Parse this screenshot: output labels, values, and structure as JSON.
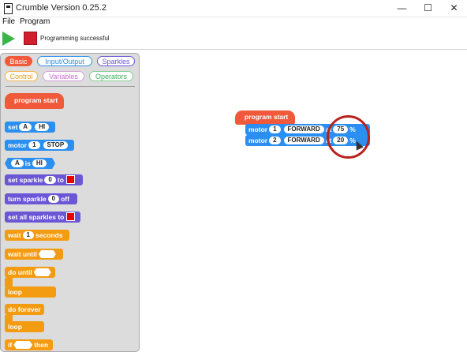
{
  "window": {
    "title": "Crumble Version 0.25.2",
    "minimize": "—",
    "maximize": "☐",
    "close": "✕"
  },
  "menu": {
    "file": "File",
    "program": "Program"
  },
  "toolbar": {
    "status": "Programming successful"
  },
  "palette": {
    "tabs": [
      "Basic",
      "Input/Output",
      "Sparkles",
      "Control",
      "Variables",
      "Operators"
    ],
    "blocks": {
      "program_start": "program start",
      "set": "set",
      "set_pin": "A",
      "set_value": "HI",
      "motor": "motor",
      "motor_num": "1",
      "motor_state": "STOP",
      "cond_pin": "A",
      "cond_is": "is",
      "cond_val": "HI",
      "set_sparkle": "set sparkle",
      "sparkle_num": "0",
      "to": "to",
      "turn_sparkle": "turn sparkle",
      "turn_num": "0",
      "off": "off",
      "set_all": "set all sparkles to",
      "wait": "wait",
      "wait_num": "1",
      "seconds": "seconds",
      "wait_until": "wait until",
      "do_until": "do until",
      "loop1": "loop",
      "do_forever": "do forever",
      "loop2": "loop",
      "if": "if",
      "then": "then"
    }
  },
  "program": {
    "start": "program start",
    "rows": [
      {
        "motor": "motor",
        "num": "1",
        "direction": "FORWARD",
        "at": "at",
        "speed": "75",
        "unit": "%"
      },
      {
        "motor": "motor",
        "num": "2",
        "direction": "FORWARD",
        "at": "at",
        "speed": "20",
        "unit": "%"
      }
    ]
  },
  "colors": {
    "motion": "#2a8ff0",
    "sparkles": "#6b57d6",
    "control": "#f39c12",
    "start": "#f05a3a",
    "highlight": "#b8211d"
  }
}
